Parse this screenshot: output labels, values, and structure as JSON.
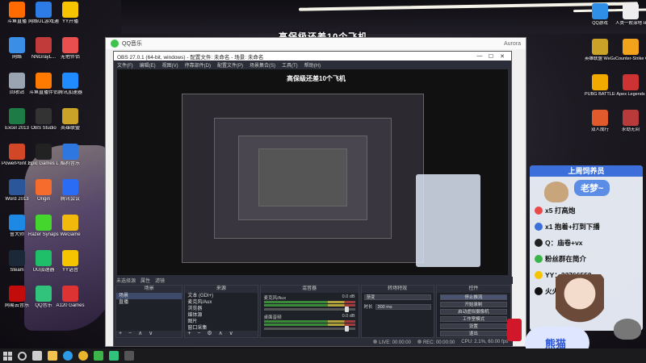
{
  "stream_overlay": {
    "banner_title": "高保级还差10个飞机",
    "card_title": "上周饲养员",
    "streamer_name": "老梦~",
    "rows": [
      {
        "icon": "rocket-icon",
        "text": "x5 打高炮"
      },
      {
        "icon": "wheel-icon",
        "text": "x1 抱着+打到下播"
      },
      {
        "icon": "penguin-icon",
        "text": "Q：庙卷+vx"
      },
      {
        "icon": "wechat-icon",
        "text": "粉丝群在简介"
      },
      {
        "icon": "yy-icon",
        "text": "YY：33766550"
      },
      {
        "icon": "tiktok-icon",
        "text": "火火只是来看看"
      }
    ],
    "paw_badge": "熊猫",
    "accent_color": "#3c6fd9"
  },
  "desktop": {
    "left_icons": [
      {
        "label": "斗鱼直播",
        "color": "#ff6b00"
      },
      {
        "label": "网络UL游戏通",
        "color": "#2d7be5"
      },
      {
        "label": "YY开播",
        "color": "#f6c400"
      },
      {
        "label": "网络",
        "color": "#3a8ee6"
      },
      {
        "label": "NNGrayL...",
        "color": "#c23b3b"
      },
      {
        "label": "无他伴侣",
        "color": "#e94f4f"
      },
      {
        "label": "回收站",
        "color": "#9aa5b1"
      },
      {
        "label": "斗鱼直播伴侣",
        "color": "#ff7a00"
      },
      {
        "label": "腾讯加速器",
        "color": "#1f8bff"
      },
      {
        "label": "Excel 2013",
        "color": "#1d7b45"
      },
      {
        "label": "OBS Studio",
        "color": "#333"
      },
      {
        "label": "英雄联盟",
        "color": "#c9a227"
      },
      {
        "label": "PowerPoint 2013",
        "color": "#d24726"
      },
      {
        "label": "Epic Games Launcher",
        "color": "#222"
      },
      {
        "label": "酷狗音乐",
        "color": "#2f77e0"
      },
      {
        "label": "Word 2013",
        "color": "#2b579a"
      },
      {
        "label": "Origin",
        "color": "#f56c2d"
      },
      {
        "label": "腾讯会议",
        "color": "#2a6df4"
      },
      {
        "label": "鲁大师",
        "color": "#1e88e5"
      },
      {
        "label": "Razer Synapse",
        "color": "#44d62c"
      },
      {
        "label": "WeGame",
        "color": "#f0b90b"
      },
      {
        "label": "Steam",
        "color": "#1b2838"
      },
      {
        "label": "UU加速器",
        "color": "#1fbf6a"
      },
      {
        "label": "YY语音",
        "color": "#f6c400"
      },
      {
        "label": "网易云音乐",
        "color": "#c20c0c"
      },
      {
        "label": "QQ音乐",
        "color": "#31c27c"
      },
      {
        "label": "A120 Games",
        "color": "#d33"
      }
    ],
    "right_icons": [
      {
        "label": "QQ游戏",
        "color": "#2f8fe6"
      },
      {
        "label": "人类一败涂地 Human Fall Flat",
        "color": "#eee"
      },
      {
        "label": "英雄联盟 WeGame",
        "color": "#c9a227"
      },
      {
        "label": "Counter-Strike Global Off...",
        "color": "#f3a31b"
      },
      {
        "label": "PUBG BATTLEGR...",
        "color": "#f2a900"
      },
      {
        "label": "Apex Legends",
        "color": "#cd3333"
      },
      {
        "label": "双人成行",
        "color": "#e05a2b"
      },
      {
        "label": "永劫无间",
        "color": "#b83a3a"
      }
    ]
  },
  "qq_music": {
    "title": "QQ音乐",
    "user": "Aurora"
  },
  "obs": {
    "window_title": "OBS 27.0.1 (64-bit, windows) - 配置文件: 未命名 - 场景: 未命名",
    "menu": [
      "文件(F)",
      "编辑(E)",
      "视图(V)",
      "停靠部件(D)",
      "配置文件(P)",
      "场景集合(S)",
      "工具(T)",
      "帮助(H)"
    ],
    "preview_banner": "高保级还差10个飞机",
    "panel_tabs": [
      "未选择源",
      "属性",
      "滤镜"
    ],
    "scenes": {
      "title": "场景",
      "items": [
        "场景",
        "直播"
      ],
      "selected": 0,
      "footer": "+ − ∧ ∨"
    },
    "sources": {
      "title": "来源",
      "items": [
        "文本 (GDI+)",
        "麦克风/Aux",
        "浏览器",
        "媒体源",
        "图片",
        "窗口采集"
      ],
      "footer": "+ − ⚙ ∧ ∨"
    },
    "mixer": {
      "title": "混音器",
      "channels": [
        {
          "name": "麦克风/Aux",
          "db": "0.0 dB"
        },
        {
          "name": "桌面音频",
          "db": "0.0 dB"
        }
      ]
    },
    "transitions": {
      "title": "转场特效",
      "type_label": "渐变",
      "duration_label": "时长",
      "duration_value": "300 ms"
    },
    "controls": {
      "title": "控件",
      "buttons": [
        "停止推流",
        "开始录制",
        "启动虚拟摄像机",
        "工作室模式",
        "设置",
        "退出"
      ]
    },
    "status": {
      "live": "LIVE: 00:00:00",
      "rec": "REC: 00:00:00",
      "cpu": "CPU: 2.1%, 60.00 fps"
    }
  },
  "taskbar": {
    "items": [
      {
        "icon": "windows-start-icon",
        "color": "#ccc"
      },
      {
        "icon": "search-icon",
        "color": "#ccc"
      },
      {
        "icon": "task-view-icon",
        "color": "#ccc"
      },
      {
        "icon": "file-explorer-icon",
        "color": "#f2c14e"
      },
      {
        "icon": "edge-icon",
        "color": "#2d9be8"
      },
      {
        "icon": "chrome-icon",
        "color": "#e8b42d"
      },
      {
        "icon": "wechat-icon",
        "color": "#3bb54a"
      },
      {
        "icon": "qq-music-icon",
        "color": "#31c27c"
      },
      {
        "icon": "obs-icon",
        "color": "#555"
      }
    ]
  }
}
